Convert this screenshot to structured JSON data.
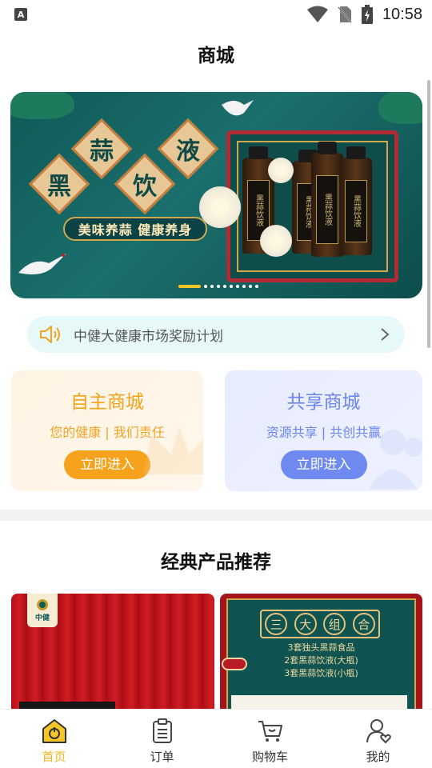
{
  "status_bar": {
    "time": "10:58",
    "notification_icon": "A"
  },
  "header": {
    "title": "商城"
  },
  "banner": {
    "characters": [
      "黑",
      "蒜",
      "饮",
      "液"
    ],
    "slogan": "美味养蒜 健康养身",
    "bottle_label": "黑蒜饮液",
    "slide_count": 10,
    "active_slide": 1
  },
  "notice": {
    "text": "中健大健康市场奖励计划"
  },
  "stores": [
    {
      "title": "自主商城",
      "subtitle": "您的健康 | 我们责任",
      "button": "立即进入"
    },
    {
      "title": "共享商城",
      "subtitle": "资源共享 | 共创共赢",
      "button": "立即进入"
    }
  ],
  "section": {
    "title": "经典产品推荐"
  },
  "products": [
    {
      "badge": "中健"
    },
    {
      "scroll_chars": [
        "三",
        "大",
        "组",
        "合"
      ],
      "lines": [
        "3套独头黑蒜食品",
        "2套黑蒜饮液(大瓶)",
        "3套黑蒜饮液(小瓶)"
      ]
    }
  ],
  "bottom_nav": [
    {
      "label": "首页",
      "icon": "home-icon",
      "active": true
    },
    {
      "label": "订单",
      "icon": "order-clipboard-icon",
      "active": false
    },
    {
      "label": "购物车",
      "icon": "shopping-cart-icon",
      "active": false
    },
    {
      "label": "我的",
      "icon": "profile-icon",
      "active": false
    }
  ],
  "colors": {
    "accent": "#f3b61c",
    "orange": "#f7a21c",
    "blue": "#6e8af1",
    "teal": "#0f5a58"
  }
}
